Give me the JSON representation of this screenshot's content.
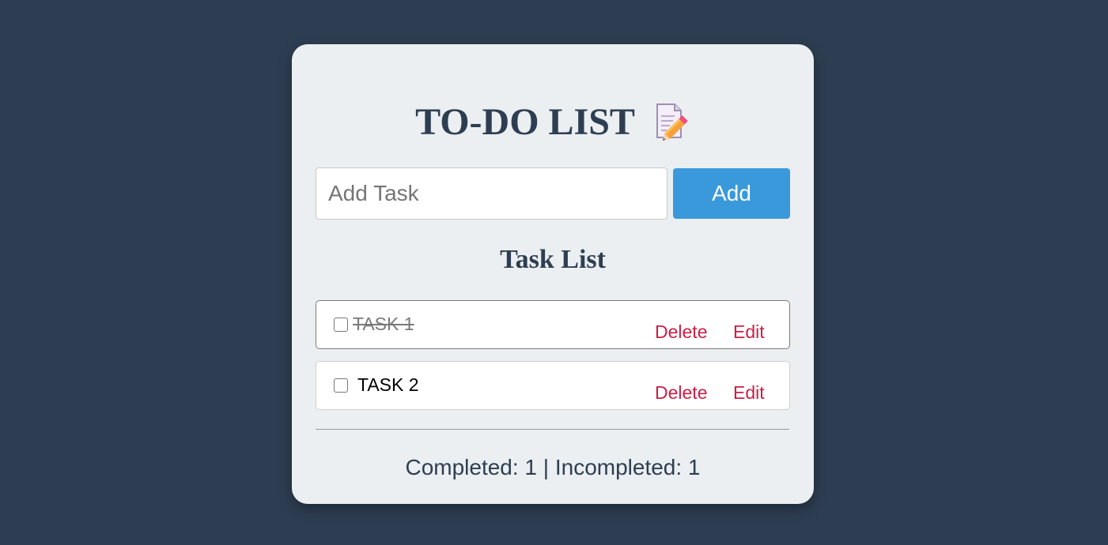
{
  "app": {
    "title": "TO-DO LIST",
    "title_icon": "memo-pencil-icon"
  },
  "input": {
    "placeholder": "Add Task",
    "value": ""
  },
  "add_button": {
    "label": "Add"
  },
  "task_list": {
    "heading": "Task List",
    "tasks": [
      {
        "text": "TASK 1",
        "completed": true,
        "delete_label": "Delete",
        "edit_label": "Edit"
      },
      {
        "text": "TASK 2",
        "completed": false,
        "delete_label": "Delete",
        "edit_label": "Edit"
      }
    ]
  },
  "status": {
    "text": "Completed: 1 | Incompleted: 1"
  },
  "colors": {
    "background": "#2e3e52",
    "card": "#ebeff1",
    "accent": "#3999db",
    "action": "#cc1f45",
    "heading": "#2e3e52"
  }
}
